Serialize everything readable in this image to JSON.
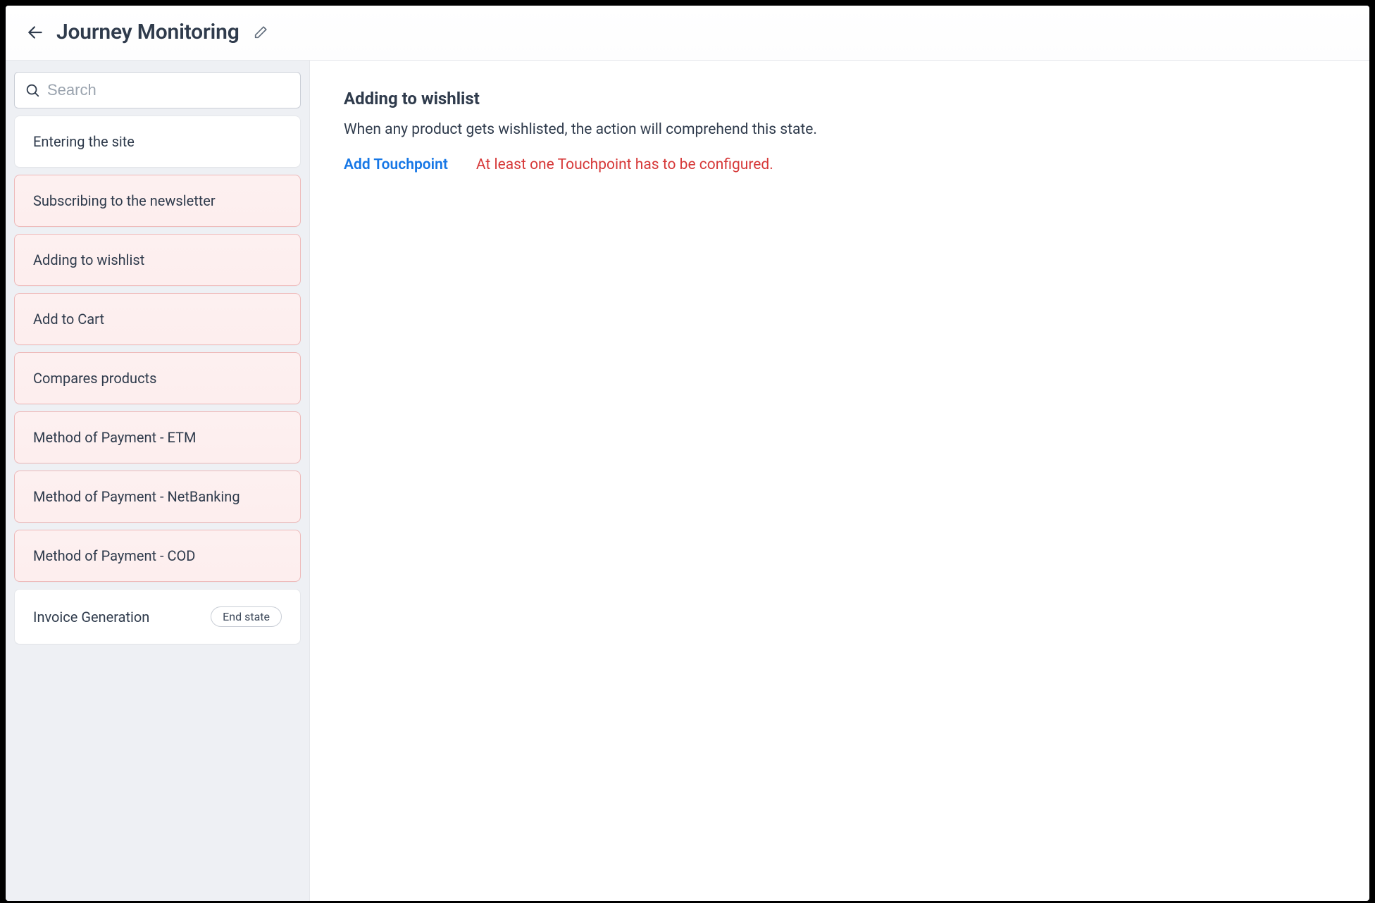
{
  "header": {
    "title": "Journey Monitoring"
  },
  "sidebar": {
    "search_placeholder": "Search",
    "states": [
      {
        "label": "Entering the site",
        "error": false,
        "end_state": false
      },
      {
        "label": "Subscribing to the newsletter",
        "error": true,
        "end_state": false
      },
      {
        "label": "Adding to wishlist",
        "error": true,
        "end_state": false
      },
      {
        "label": "Add to Cart",
        "error": true,
        "end_state": false
      },
      {
        "label": "Compares products",
        "error": true,
        "end_state": false
      },
      {
        "label": "Method of Payment - ETM",
        "error": true,
        "end_state": false
      },
      {
        "label": "Method of Payment - NetBanking",
        "error": true,
        "end_state": false
      },
      {
        "label": "Method of Payment - COD",
        "error": true,
        "end_state": false
      },
      {
        "label": "Invoice Generation",
        "error": false,
        "end_state": true
      }
    ],
    "end_state_badge": "End state"
  },
  "main": {
    "title": "Adding to wishlist",
    "description": "When any product gets wishlisted, the action will comprehend this state.",
    "add_touchpoint_label": "Add Touchpoint",
    "warning": "At least one Touchpoint has to be configured."
  }
}
